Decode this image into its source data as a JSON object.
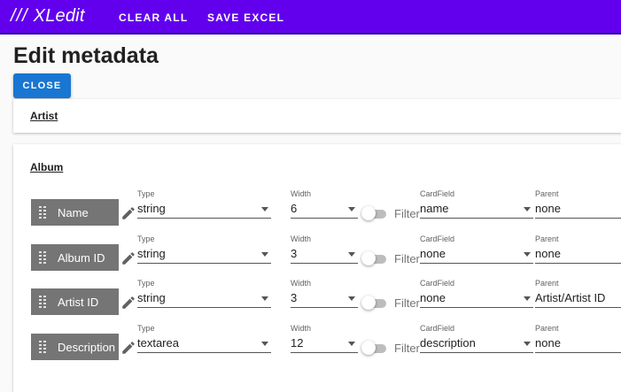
{
  "appbar": {
    "brand_slashes": "///",
    "brand_name": "XLedit",
    "clear_all": "CLEAR ALL",
    "save_excel": "SAVE EXCEL"
  },
  "page": {
    "title": "Edit metadata",
    "close": "CLOSE"
  },
  "panels": {
    "artist": "Artist",
    "album": "Album"
  },
  "labels": {
    "type": "Type",
    "width": "Width",
    "filter": "Filter",
    "cardfield": "CardField",
    "parent": "Parent"
  },
  "rows": [
    {
      "name": "Name",
      "type": "string",
      "width": "6",
      "filter": false,
      "cardfield": "name",
      "parent": "none"
    },
    {
      "name": "Album ID",
      "type": "string",
      "width": "3",
      "filter": false,
      "cardfield": "none",
      "parent": "none"
    },
    {
      "name": "Artist ID",
      "type": "string",
      "width": "3",
      "filter": false,
      "cardfield": "none",
      "parent": "Artist/Artist ID"
    },
    {
      "name": "Description",
      "type": "textarea",
      "width": "12",
      "filter": false,
      "cardfield": "description",
      "parent": "none"
    }
  ],
  "colors": {
    "appbar": "#6200ee",
    "primary_button": "#1976d2",
    "chip": "#757575"
  }
}
